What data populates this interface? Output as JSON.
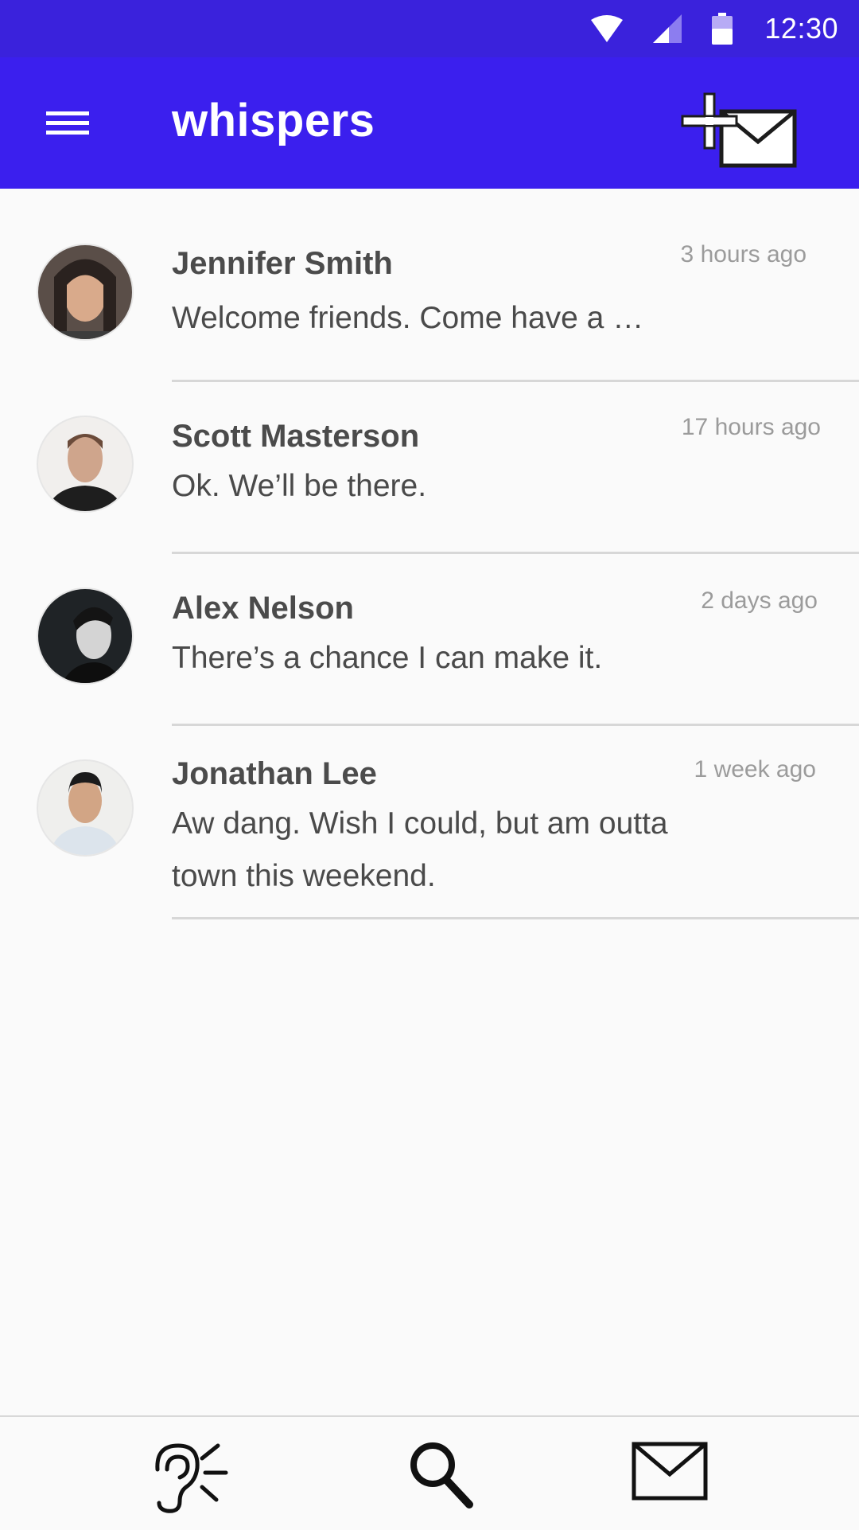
{
  "status_bar": {
    "time": "12:30"
  },
  "app_bar": {
    "title": "whispers",
    "accent_color": "#3b1fee"
  },
  "conversations": [
    {
      "name": "Jennifer Smith",
      "message": "Welcome friends. Come have a …",
      "time": "3 hours ago"
    },
    {
      "name": "Scott Masterson",
      "message": "Ok. We’ll be there.",
      "time": "17 hours ago"
    },
    {
      "name": "Alex Nelson",
      "message": "There’s a chance I can make it.",
      "time": "2 days ago"
    },
    {
      "name": "Jonathan Lee",
      "message": "Aw dang. Wish I could, but am outta town this weekend.",
      "time": "1 week ago"
    }
  ],
  "icons": {
    "menu": "hamburger-menu-icon",
    "compose": "new-message-icon",
    "nav_listen": "ear-icon",
    "nav_search": "search-icon",
    "nav_messages": "mail-icon"
  }
}
